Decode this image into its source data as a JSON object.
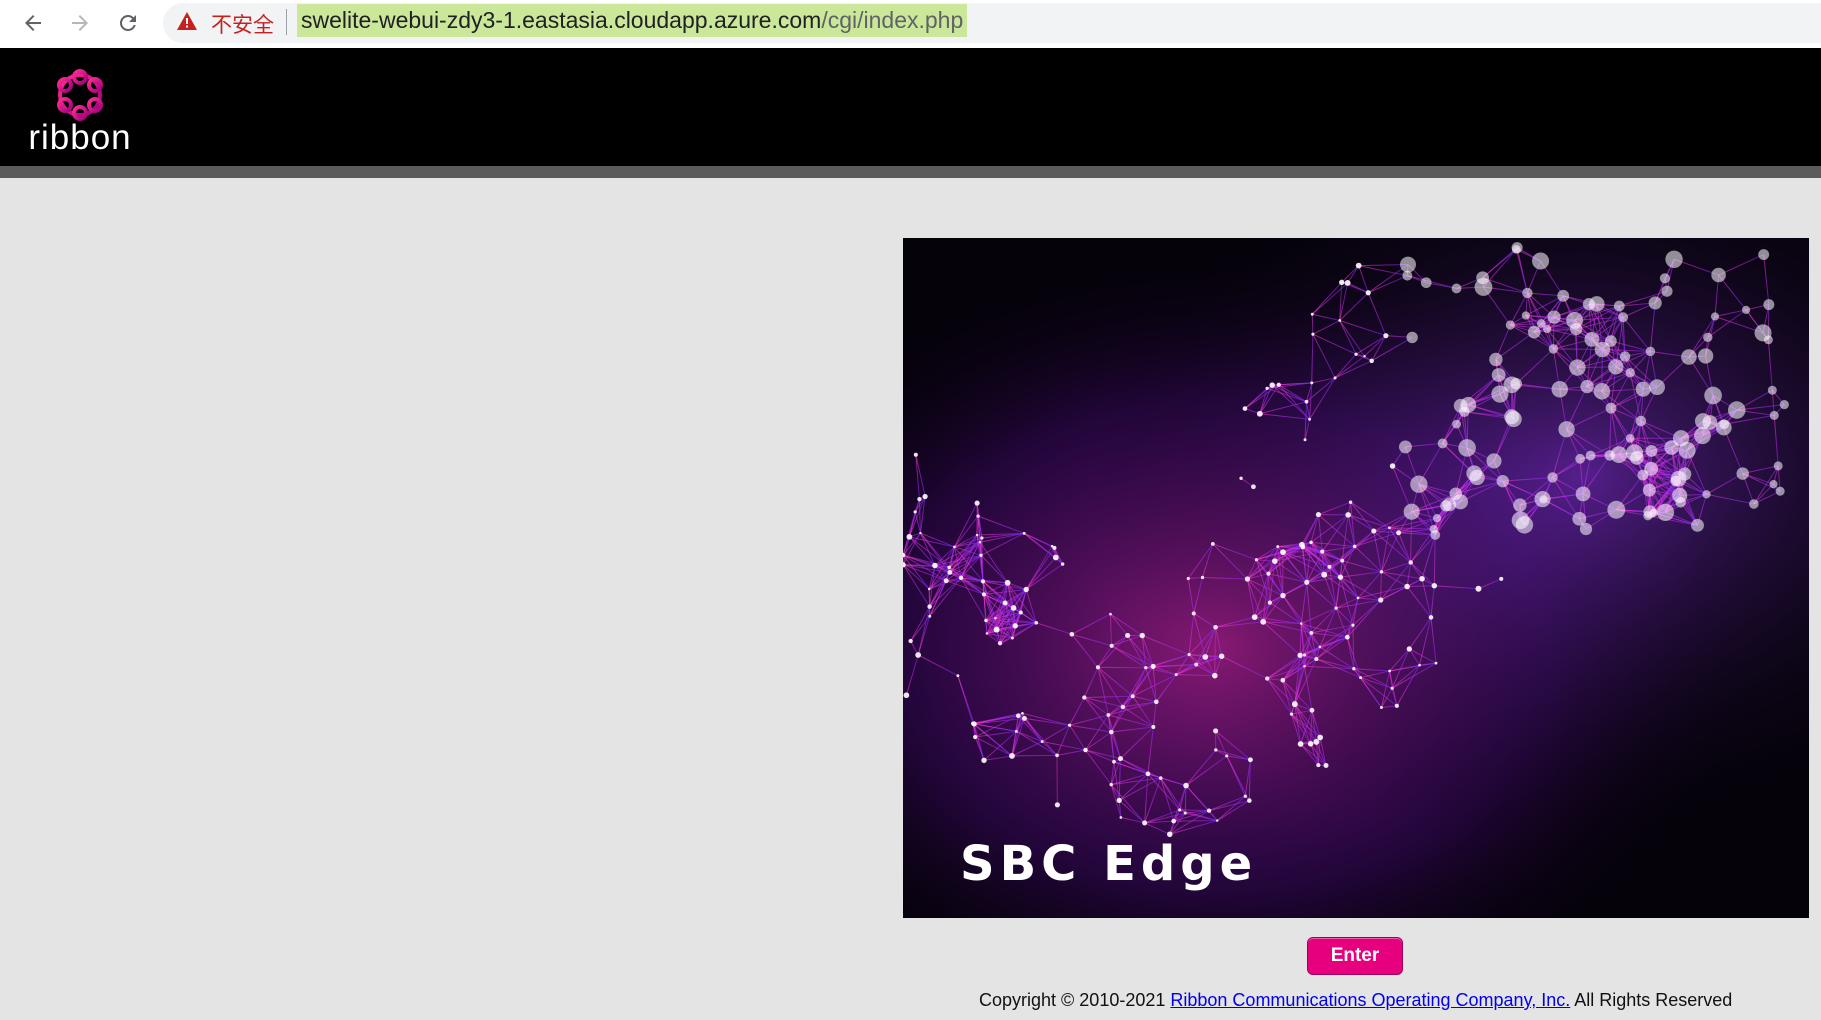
{
  "browser": {
    "insecure_label": "不安全",
    "url_host": "swelite-webui-zdy3-1.eastasia.cloudapp.azure.com",
    "url_path": "/cgi/index.php"
  },
  "header": {
    "logo_text": "ribbon"
  },
  "hero": {
    "title": "SBC Edge"
  },
  "enter_label": "Enter",
  "footer": {
    "prefix": "Copyright © 2010-2021 ",
    "link": "Ribbon Communications Operating Company, Inc.",
    "suffix": " All Rights Reserved"
  },
  "colors": {
    "accent": "#e6007e",
    "header_bg": "#000000",
    "page_bg": "#e4e4e4",
    "url_highlight": "#cbe89a"
  }
}
